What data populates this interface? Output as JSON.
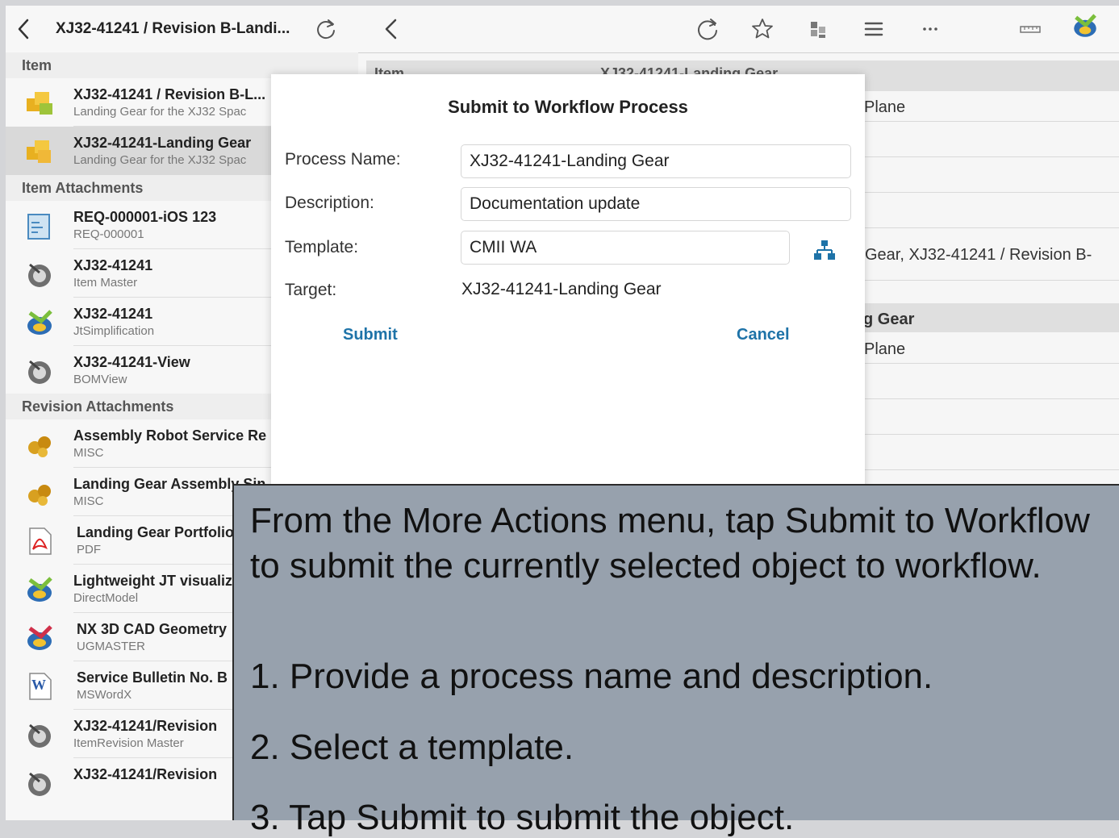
{
  "left_pane": {
    "title": "XJ32-41241 / Revision B-Landi...",
    "sections": {
      "item": "Item",
      "item_attachments": "Item Attachments",
      "revision_attachments": "Revision Attachments"
    },
    "item_rows": [
      {
        "title": "XJ32-41241 / Revision B-L...",
        "subtitle": "Landing Gear for the XJ32 Spac",
        "icon": "item-revision-icon"
      },
      {
        "title": "XJ32-41241-Landing Gear",
        "subtitle": "Landing Gear for the XJ32 Spac",
        "icon": "item-icon"
      }
    ],
    "item_attachment_rows": [
      {
        "title": "REQ-000001-iOS 123",
        "subtitle": "REQ-000001",
        "icon": "requirement-icon"
      },
      {
        "title": "XJ32-41241",
        "subtitle": "Item Master",
        "icon": "form-icon"
      },
      {
        "title": "XJ32-41241",
        "subtitle": "JtSimplification",
        "icon": "jt-icon"
      },
      {
        "title": "XJ32-41241-View",
        "subtitle": "BOMView",
        "icon": "form-icon"
      }
    ],
    "revision_attachment_rows": [
      {
        "title": "Assembly Robot Service Re",
        "subtitle": "MISC",
        "icon": "misc-icon"
      },
      {
        "title": "Landing Gear Assembly Sin",
        "subtitle": "MISC",
        "icon": "misc-icon"
      },
      {
        "title": "Landing Gear Portfolio",
        "subtitle": "PDF",
        "icon": "pdf-icon"
      },
      {
        "title": "Lightweight JT visualiz",
        "subtitle": "DirectModel",
        "icon": "jt-icon"
      },
      {
        "title": "NX 3D CAD Geometry",
        "subtitle": "UGMASTER",
        "icon": "nx-icon"
      },
      {
        "title": "Service Bulletin No. B",
        "subtitle": "MSWordX",
        "icon": "word-icon"
      },
      {
        "title": "XJ32-41241/Revision",
        "subtitle": "ItemRevision Master",
        "icon": "form-icon"
      },
      {
        "title": "XJ32-41241/Revision",
        "subtitle": "",
        "icon": "form-icon"
      }
    ]
  },
  "right_pane": {
    "header_left": "Item",
    "header_right": "XJ32-41241-Landing Gear",
    "values": {
      "plane_1": "Plane",
      "related": "Gear, XJ32-41241 / Revision B-",
      "band": "g Gear",
      "plane_2": "Plane"
    }
  },
  "dialog": {
    "title": "Submit to Workflow Process",
    "labels": {
      "process_name": "Process Name:",
      "description": "Description:",
      "template": "Template:",
      "target": "Target:"
    },
    "values": {
      "process_name": "XJ32-41241-Landing Gear",
      "description": "Documentation update",
      "template": "CMII WA",
      "target": "XJ32-41241-Landing Gear"
    },
    "submit_label": "Submit",
    "cancel_label": "Cancel"
  },
  "tooltip": {
    "intro": "From the More Actions menu, tap Submit to Workflow to submit the currently selected object to workflow.",
    "steps": [
      "1.  Provide a process name and description.",
      "2.  Select a template.",
      "3.  Tap Submit to submit the object."
    ]
  },
  "colors": {
    "accent_link": "#1e73a8",
    "tooltip_bg": "#97a1ad",
    "selected_row": "#d9d9d9"
  }
}
